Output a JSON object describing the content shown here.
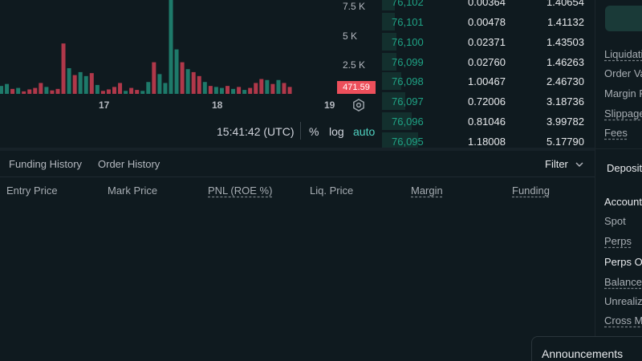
{
  "chart": {
    "y_axis": [
      "7.5 K",
      "5 K",
      "2.5 K"
    ],
    "x_axis": [
      "17",
      "18",
      "19"
    ],
    "price_tag": "471.59",
    "time": "15:41:42 (UTC)",
    "percent_label": "%",
    "log_label": "log",
    "auto_label": "auto"
  },
  "chart_data": {
    "type": "bar",
    "categories": [],
    "ylim": [
      0,
      9500
    ],
    "x_ticks": [
      "17",
      "18",
      "19"
    ],
    "y_ticks": [
      "2.5 K",
      "5 K",
      "7.5 K"
    ],
    "series": [
      {
        "values": [
          800,
          1000,
          500,
          600,
          250,
          450,
          600,
          1100,
          700,
          350,
          500,
          5100,
          2600,
          1900,
          2200,
          1800,
          2100,
          900,
          300,
          450,
          700,
          1100,
          300,
          600,
          400,
          300,
          1200,
          3200,
          2000,
          1100,
          9800,
          4500,
          3200,
          2500,
          2200,
          1800,
          1200,
          800,
          700,
          600,
          800,
          500,
          700,
          400,
          600,
          1100,
          1500,
          1400,
          1000,
          1400,
          1100,
          700
        ],
        "colors": [
          "g",
          "g",
          "r",
          "g",
          "r",
          "r",
          "r",
          "r",
          "g",
          "r",
          "r",
          "r",
          "g",
          "r",
          "g",
          "g",
          "r",
          "g",
          "r",
          "r",
          "r",
          "r",
          "g",
          "r",
          "r",
          "g",
          "g",
          "r",
          "g",
          "g",
          "g",
          "g",
          "r",
          "g",
          "r",
          "r",
          "g",
          "r",
          "g",
          "g",
          "r",
          "g",
          "r",
          "g",
          "r",
          "r",
          "r",
          "g",
          "r",
          "g",
          "r",
          "r"
        ]
      }
    ]
  },
  "orderbook": [
    {
      "price": "76,102",
      "size": "0.00364",
      "total": "1.40654",
      "depth": 0.06
    },
    {
      "price": "76,101",
      "size": "0.00478",
      "total": "1.41132",
      "depth": 0.06
    },
    {
      "price": "76,100",
      "size": "0.02371",
      "total": "1.43503",
      "depth": 0.07
    },
    {
      "price": "76,099",
      "size": "0.02760",
      "total": "1.46263",
      "depth": 0.07
    },
    {
      "price": "76,098",
      "size": "1.00467",
      "total": "2.46730",
      "depth": 0.09
    },
    {
      "price": "76,097",
      "size": "0.72006",
      "total": "3.18736",
      "depth": 0.11
    },
    {
      "price": "76,096",
      "size": "0.81046",
      "total": "3.99782",
      "depth": 0.14
    },
    {
      "price": "76,095",
      "size": "1.18008",
      "total": "5.17790",
      "depth": 0.17
    }
  ],
  "right_panel": {
    "top_items": [
      "Liquidati",
      "Order Va",
      "Margin R",
      "Slippage",
      "Fees"
    ],
    "deposits": "Deposits",
    "account": "Account",
    "spot": "Spot",
    "perps": "Perps",
    "perps_overview": "Perps Ov",
    "balance": "Balance",
    "unrealized": "Unrealize",
    "cross_margin": "Cross Ma"
  },
  "bottom": {
    "tabs": [
      "Funding History",
      "Order History"
    ],
    "filter": "Filter",
    "columns": [
      "Entry Price",
      "Mark Price",
      "PNL (ROE %)",
      "Liq. Price",
      "Margin",
      "Funding"
    ]
  },
  "announcements": "Announcements",
  "colors": {
    "green": "#1fa385",
    "red": "#ed4f5b",
    "green_bar": "#1e7a6a",
    "red_bar": "#b0384a"
  }
}
